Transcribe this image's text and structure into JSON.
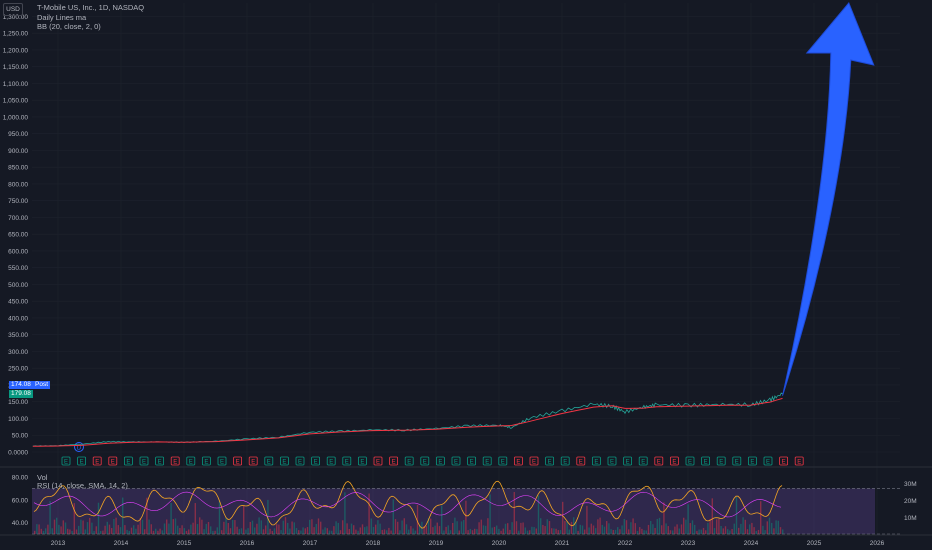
{
  "header": {
    "currency": "USD",
    "title": "T-Mobile US, Inc., 1D, NASDAQ",
    "indicator1": "Daily Lines ma",
    "indicator2": "BB (20, close, 2, 0)",
    "rsi_label": "Vol",
    "rsi_params": "RSI (14, close, SMA, 14, 2)"
  },
  "price_tags": {
    "last": "174.08",
    "post": "Post",
    "ma": "179.08"
  },
  "colors": {
    "background": "#151924",
    "arrow": "#2962ff",
    "price_line": "#26a69a",
    "ma_line": "#f23645",
    "rsi_line": "#f6a623",
    "rsi_band": "#7e57c2"
  },
  "chart_data": [
    {
      "type": "line",
      "title": "T-Mobile US, Inc., 1D, NASDAQ",
      "x_ticks": [
        "2013",
        "2014",
        "2015",
        "2016",
        "2017",
        "2018",
        "2019",
        "2020",
        "2021",
        "2022",
        "2023",
        "2024",
        "2025",
        "2026"
      ],
      "y_ticks": [
        "0.0000",
        "50.00",
        "100.00",
        "150.00",
        "200.00",
        "250.00",
        "300.00",
        "350.00",
        "400.00",
        "450.00",
        "500.00",
        "550.00",
        "600.00",
        "650.00",
        "700.00",
        "750.00",
        "800.00",
        "850.00",
        "900.00",
        "950.00",
        "1,000.00",
        "1,050.00",
        "1,100.00",
        "1,150.00",
        "1,200.00",
        "1,250.00",
        "1,300.00"
      ],
      "ylim": [
        0,
        1340
      ],
      "x": [
        2012.6,
        2013.0,
        2013.4,
        2013.8,
        2014.2,
        2014.6,
        2015.0,
        2015.5,
        2016.0,
        2016.5,
        2017.0,
        2017.5,
        2018.0,
        2018.5,
        2019.0,
        2019.5,
        2020.0,
        2020.2,
        2020.5,
        2021.0,
        2021.5,
        2021.8,
        2022.0,
        2022.3,
        2022.5,
        2023.0,
        2023.5,
        2024.0,
        2024.3,
        2024.5
      ],
      "series": [
        {
          "values": [
            18,
            19,
            24,
            31,
            30,
            30,
            29,
            32,
            39,
            44,
            59,
            62,
            66,
            65,
            70,
            78,
            80,
            73,
            102,
            123,
            143,
            136,
            120,
            134,
            141,
            139,
            142,
            141,
            155,
            174
          ]
        },
        {
          "values": [
            17,
            18,
            20,
            26,
            29,
            30,
            29,
            31,
            36,
            42,
            54,
            60,
            64,
            65,
            68,
            74,
            78,
            79,
            92,
            115,
            134,
            138,
            130,
            131,
            135,
            137,
            139,
            140,
            149,
            160
          ]
        }
      ],
      "projection": {
        "x": [
          2024.5,
          2025.6
        ],
        "y": [
          174,
          1340
        ]
      }
    },
    {
      "type": "line",
      "ylabel": "",
      "y_ticks": [
        "40.00",
        "60.00",
        "80.00"
      ],
      "ylim": [
        30,
        88
      ],
      "band": [
        30,
        70
      ],
      "volume_ticks": [
        "10M",
        "20M",
        "30M"
      ]
    }
  ]
}
